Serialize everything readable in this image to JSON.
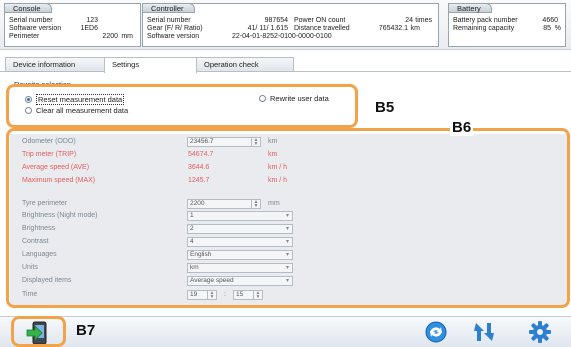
{
  "console": {
    "title": "Console",
    "rows": [
      {
        "label": "Serial number",
        "value": "123",
        "unit": ""
      },
      {
        "label": "Software version",
        "value": "1ED6",
        "unit": ""
      },
      {
        "label": "Perimeter",
        "value": "2200",
        "unit": "mm"
      }
    ]
  },
  "controller": {
    "title": "Controller",
    "rows": [
      {
        "label": "Serial number",
        "value": "987654"
      },
      {
        "label": "Gear (F/ R/ Ratio)",
        "value": "41/ 11/ 1.615"
      },
      {
        "label": "Software version",
        "value": "22-04-01-8252-0100-0000-0100"
      }
    ],
    "right_rows": [
      {
        "label": "Power ON count",
        "value": "24",
        "unit": "times"
      },
      {
        "label": "Distance travelled",
        "value": "765432.1",
        "unit": "km"
      }
    ]
  },
  "battery": {
    "title": "Battery",
    "rows": [
      {
        "label": "Battery pack number",
        "value": "4660",
        "unit": ""
      },
      {
        "label": "Remaining capacity",
        "value": "85",
        "unit": "%"
      }
    ]
  },
  "tabs": [
    "Device information",
    "Settings",
    "Operation check"
  ],
  "active_tab": 1,
  "rewrite": {
    "section_label": "Rewrite selection",
    "options": [
      "Reset measurement data",
      "Rewrite user data",
      "Clear all measurement data"
    ],
    "selected": 0
  },
  "measurement": [
    {
      "label": "Odometer (ODO)",
      "value": "23456.7",
      "unit": "km",
      "editable": true
    },
    {
      "label": "Trip meter (TRIP)",
      "value": "54674.7",
      "unit": "km",
      "editable": false
    },
    {
      "label": "Average speed (AVE)",
      "value": "3644.6",
      "unit": "km / h",
      "editable": false
    },
    {
      "label": "Maximum speed (MAX)",
      "value": "1245.7",
      "unit": "km / h",
      "editable": false
    }
  ],
  "user_settings": {
    "tyre": {
      "label": "Tyre perimeter",
      "value": "2200",
      "unit": "mm"
    },
    "dropdowns": [
      {
        "label": "Brightness (Night mode)",
        "value": "1"
      },
      {
        "label": "Brightness",
        "value": "2"
      },
      {
        "label": "Contrast",
        "value": "4"
      },
      {
        "label": "Languages",
        "value": "English"
      },
      {
        "label": "Units",
        "value": "km"
      },
      {
        "label": "Displayed items",
        "value": "Average speed"
      }
    ],
    "time": {
      "label": "Time",
      "hour": "19",
      "minute": "15",
      "separator": ":"
    }
  },
  "callouts": {
    "b5": "B5",
    "b6": "B6",
    "b7": "B7"
  },
  "icons": {
    "exit": "exit-icon",
    "connect": "connect-icon",
    "refresh": "refresh-icon",
    "settings": "gear-icon"
  },
  "colors": {
    "callout": "#f2a349",
    "red_value": "#e45d5d",
    "accent": "#2a6fc9"
  }
}
